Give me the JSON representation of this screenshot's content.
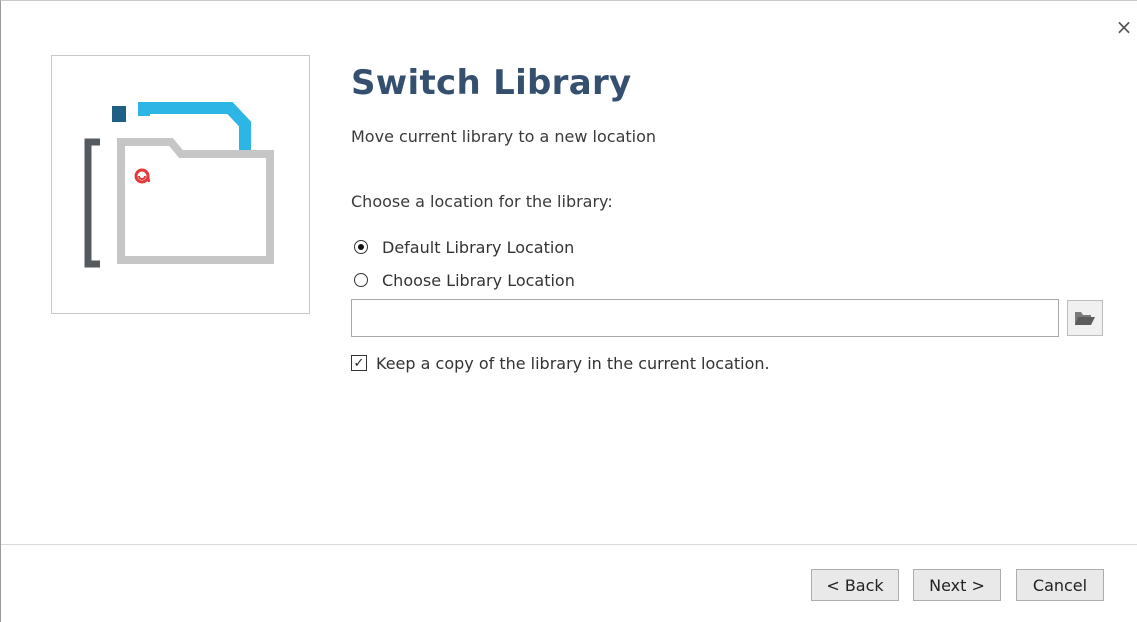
{
  "window": {
    "close_glyph": "×"
  },
  "header": {
    "title": "Switch Library",
    "subtitle": "Move current library to a new location"
  },
  "illustration": {
    "icon": "library-folder-icon",
    "colors": {
      "bracket": "#555a5f",
      "accent_square": "#1f5f85",
      "back_page": "#2db5e6",
      "folder": "#c6c6c6",
      "at_symbol": "#e03a3a"
    }
  },
  "form": {
    "prompt": "Choose a location for the library:",
    "radio_default_label": "Default Library Location",
    "radio_default_checked": true,
    "radio_choose_label": "Choose Library Location",
    "radio_choose_checked": false,
    "path_value": "",
    "path_placeholder": "",
    "browse_icon": "folder-open-icon",
    "keep_copy_label": "Keep a copy of the library in the current location.",
    "keep_copy_checked": true,
    "check_glyph": "✓"
  },
  "footer": {
    "back_label": "< Back",
    "next_label": "Next >",
    "cancel_label": "Cancel"
  }
}
